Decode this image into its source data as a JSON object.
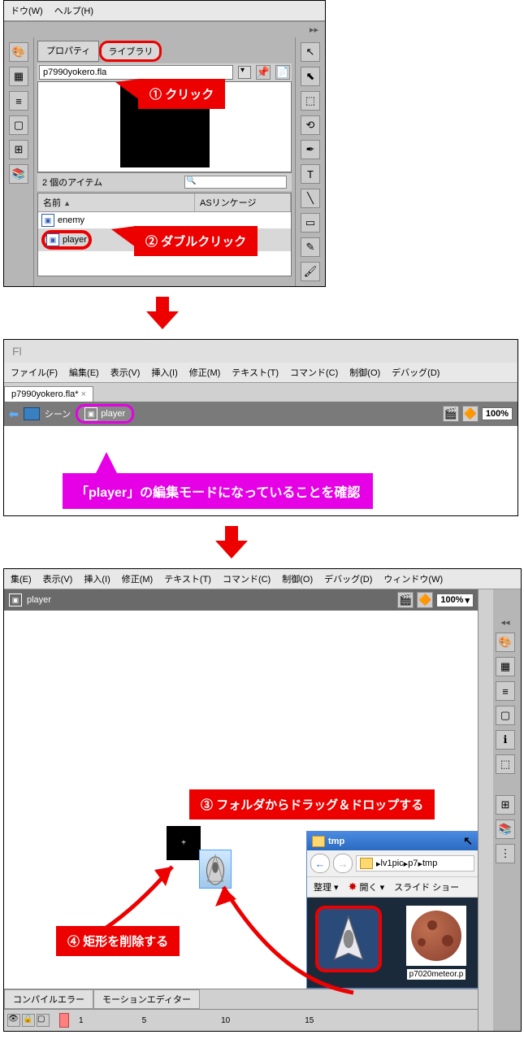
{
  "panel1": {
    "menu": {
      "window": "ドウ(W)",
      "help": "ヘルプ(H)"
    },
    "tabs": {
      "properties": "プロパティ",
      "library": "ライブラリ"
    },
    "filename": "p7990yokero.fla",
    "item_count": "2 個のアイテム",
    "columns": {
      "name": "名前",
      "linkage": "ASリンケージ"
    },
    "items": {
      "enemy": "enemy",
      "player": "player"
    }
  },
  "callouts": {
    "c1": "クリック",
    "c2": "ダブルクリック",
    "c3": "フォルダからドラッグ＆ドロップする",
    "c4": "矩形を削除する",
    "confirm": "「player」の編集モードになっていることを確認"
  },
  "panel2": {
    "menu": {
      "file": "ファイル(F)",
      "edit": "編集(E)",
      "view": "表示(V)",
      "insert": "挿入(I)",
      "modify": "修正(M)",
      "text": "テキスト(T)",
      "commands": "コマンド(C)",
      "control": "制御(O)",
      "debug": "デバッグ(D)"
    },
    "tab": "p7990yokero.fla*",
    "breadcrumb": {
      "scene": "シーン",
      "symbol": "player"
    },
    "zoom": "100%"
  },
  "panel3": {
    "menu": {
      "edit": "集(E)",
      "view": "表示(V)",
      "insert": "挿入(I)",
      "modify": "修正(M)",
      "text": "テキスト(T)",
      "commands": "コマンド(C)",
      "control": "制御(O)",
      "debug": "デバッグ(D)",
      "window": "ウィンドウ(W)"
    },
    "symbol": "player",
    "zoom": "100%",
    "bottom_tabs": {
      "compile": "コンパイルエラー",
      "motion": "モーションエディター"
    },
    "timeline": {
      "f1": "1",
      "f5": "5",
      "f10": "10",
      "f15": "15"
    },
    "explorer": {
      "title": "tmp",
      "path": {
        "p1": "lv1pic",
        "p2": "p7",
        "p3": "tmp"
      },
      "organize": "整理",
      "open": "開く",
      "slideshow": "スライド ショー",
      "thumb2": "p7020meteor.p"
    }
  },
  "nums": {
    "n1": "①",
    "n2": "②",
    "n3": "③",
    "n4": "④"
  }
}
